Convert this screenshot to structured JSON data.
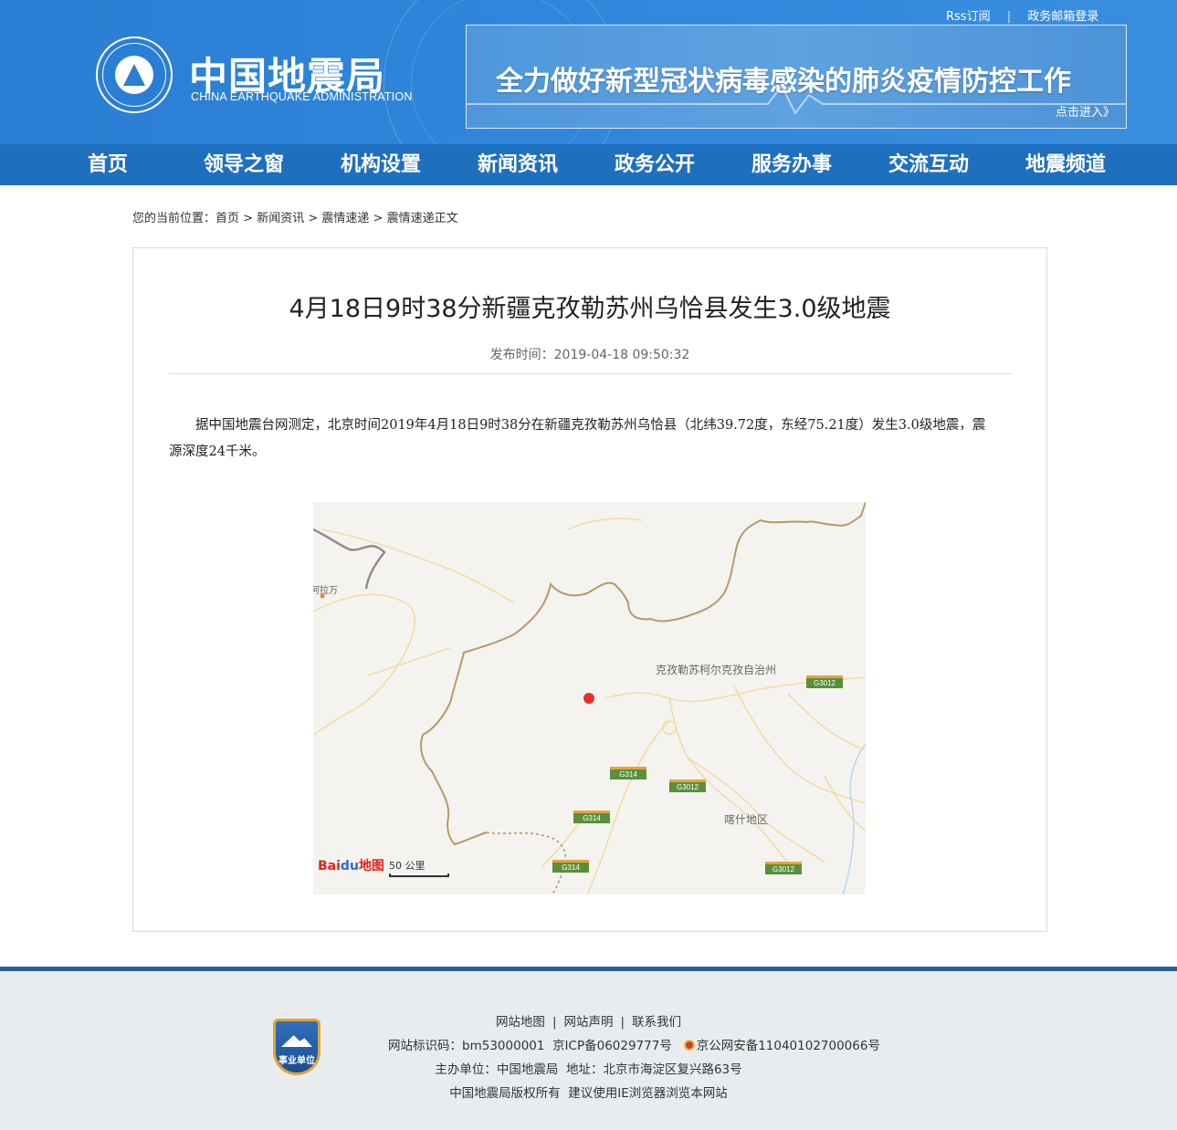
{
  "header": {
    "links": [
      "Rss订阅",
      "政务邮箱登录"
    ],
    "logo_cn": "中国地震局",
    "logo_en": "CHINA EARTHQUAKE ADMINISTRATION",
    "logo_ring_text": "CHINA EARTHQUAKE ADMINISTRATION",
    "banner_title": "全力做好新型冠状病毒感染的肺炎疫情防控工作",
    "banner_link": "点击进入》"
  },
  "nav": [
    "首页",
    "领导之窗",
    "机构设置",
    "新闻资讯",
    "政务公开",
    "服务办事",
    "交流互动",
    "地震频道"
  ],
  "breadcrumb": {
    "prefix": "您的当前位置：",
    "items": [
      "首页",
      "新闻资讯",
      "震情速递",
      "震情速递正文"
    ],
    "separator": " > "
  },
  "article": {
    "title": "4月18日9时38分新疆克孜勒苏州乌恰县发生3.0级地震",
    "date_label": "发布时间：",
    "date": "2019-04-18 09:50:32",
    "body": "据中国地震台网测定，北京时间2019年4月18日9时38分在新疆克孜勒苏州乌恰县（北纬39.72度，东经75.21度）发生3.0级地震，震源深度24千米。"
  },
  "map": {
    "labels": {
      "region1": "克孜勒苏柯尔克孜自治州",
      "region2": "喀什地区",
      "town": "阿拉万"
    },
    "shields": [
      "G3012",
      "G314",
      "G3012",
      "G314",
      "G314",
      "G3012"
    ],
    "logo": [
      "Bai",
      "du",
      "地图"
    ],
    "scale": "50 公里",
    "epicenter_color": "#e7302a"
  },
  "footer": {
    "links": [
      "网站地图",
      "网站声明",
      "联系我们"
    ],
    "line2": [
      "网站标识码：bm53000001",
      "京ICP备06029777号",
      "京公网安备11040102700066号"
    ],
    "line3": [
      "主办单位：中国地震局",
      "地址：北京市海淀区复兴路63号"
    ],
    "line4": [
      "中国地震局版权所有",
      "建议使用IE浏览器浏览本网站"
    ],
    "badge": "事业单位"
  },
  "colors": {
    "header_blue": "#2a7ed3",
    "nav_blue": "#1f6fbf",
    "footer_border": "#2a5f9e"
  }
}
